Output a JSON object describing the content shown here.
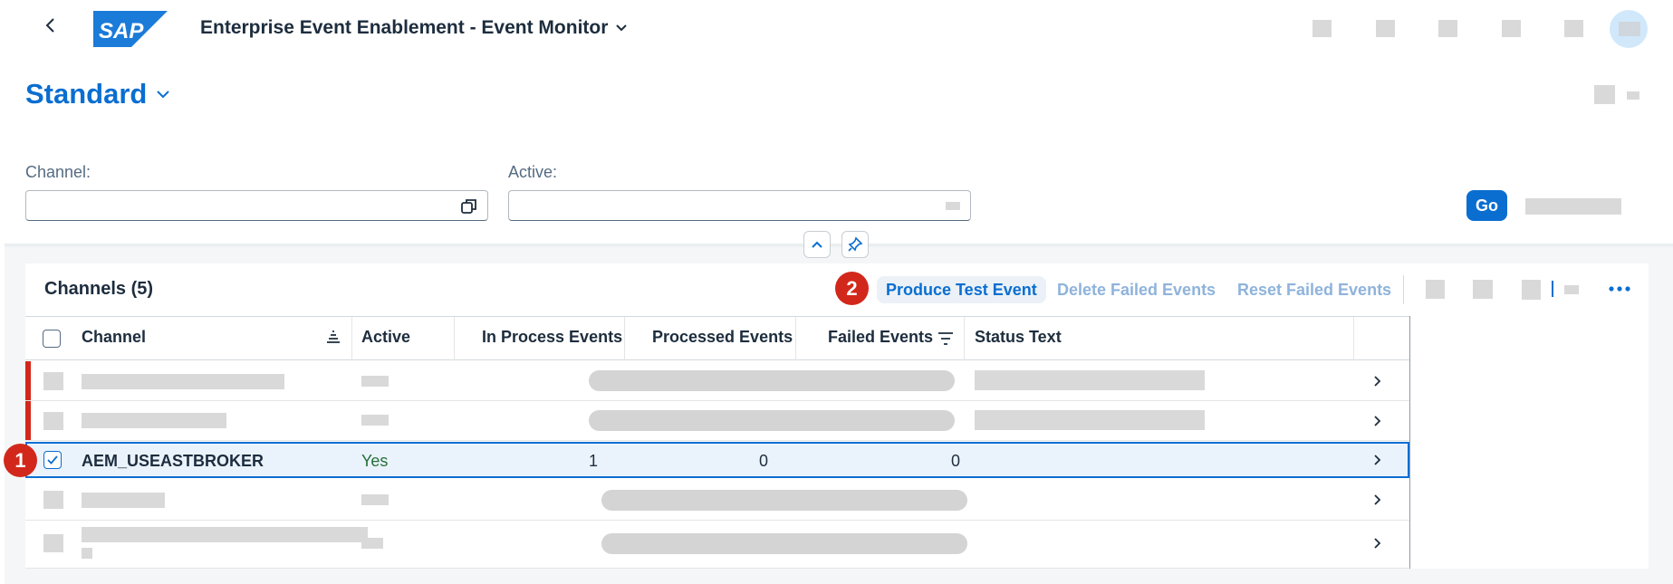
{
  "shell": {
    "app_title": "Enterprise Event Enablement - Event Monitor",
    "logo_text": "SAP"
  },
  "variant": {
    "name": "Standard"
  },
  "filters": {
    "channel_label": "Channel:",
    "active_label": "Active:",
    "channel_value": "",
    "active_value": "",
    "go_label": "Go"
  },
  "table": {
    "title": "Channels (5)",
    "toolbar": {
      "produce_test_event": "Produce Test Event",
      "delete_failed_events": "Delete Failed Events",
      "reset_failed_events": "Reset Failed Events"
    },
    "columns": {
      "channel": "Channel",
      "active": "Active",
      "in_process": "In Process Events",
      "processed": "Processed Events",
      "failed": "Failed Events",
      "status_text": "Status Text"
    },
    "selected_row": {
      "channel": "AEM_USEASTBROKER",
      "active": "Yes",
      "in_process": "1",
      "processed": "0",
      "failed": "0",
      "status_text": ""
    }
  },
  "annotations": {
    "step1": "1",
    "step2": "2"
  },
  "colors": {
    "accent": "#0a6ed1",
    "error_indicator": "#d2281b",
    "positive_text": "#256f3a"
  }
}
